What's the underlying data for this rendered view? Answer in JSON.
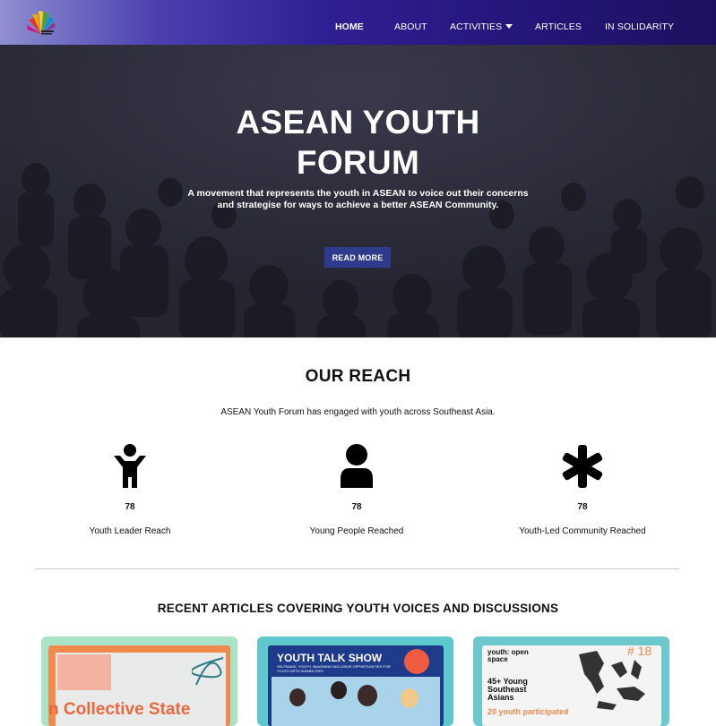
{
  "nav": {
    "items": [
      {
        "label": "HOME",
        "active": true
      },
      {
        "label": "ABOUT"
      },
      {
        "label": "ACTIVITIES",
        "dropdown": true
      },
      {
        "label": "ARTICLES"
      },
      {
        "label": "IN SOLIDARITY"
      }
    ],
    "logo_icon": "asean-youth-forum-logo"
  },
  "hero": {
    "title_line1": "ASEAN YOUTH",
    "title_line2": "FORUM",
    "subtitle": "A movement that represents the youth in ASEAN to voice out their concerns and strategise for ways to achieve a better ASEAN Community.",
    "button_label": "READ MORE"
  },
  "reach": {
    "title": "OUR REACH",
    "subtitle": "ASEAN Youth Forum has engaged with youth across Southeast Asia.",
    "stats": [
      {
        "icon": "child-icon",
        "value": "78",
        "label": "Youth Leader Reach"
      },
      {
        "icon": "user-icon",
        "value": "78",
        "label": "Young People Reached"
      },
      {
        "icon": "asterisk-icon",
        "value": "78",
        "label": "Youth-Led Community Reached"
      }
    ]
  },
  "articles": {
    "title": "RECENT ARTICLES COVERING YOUTH VOICES AND DISCUSSIONS",
    "cards": [
      {
        "text": "n Collective State"
      },
      {
        "heading": "YOUTH TALK SHOW",
        "subheading": "SELFMADE, YOUTH, IMAGINING INCLUSIVE OPPORTUNITIES FOR YOUTH WITH DISABILITIES"
      },
      {
        "heading": "youth: open space",
        "badge": "# 18",
        "line1": "45+ Young Southeast Asians",
        "line2": "20 youth participated"
      }
    ]
  },
  "colors": {
    "nav_gradient_start": "#8f8fd0",
    "nav_gradient_end": "#1c1160",
    "button": "#2e3a8c",
    "hero_overlay": "#2c2b3b"
  }
}
